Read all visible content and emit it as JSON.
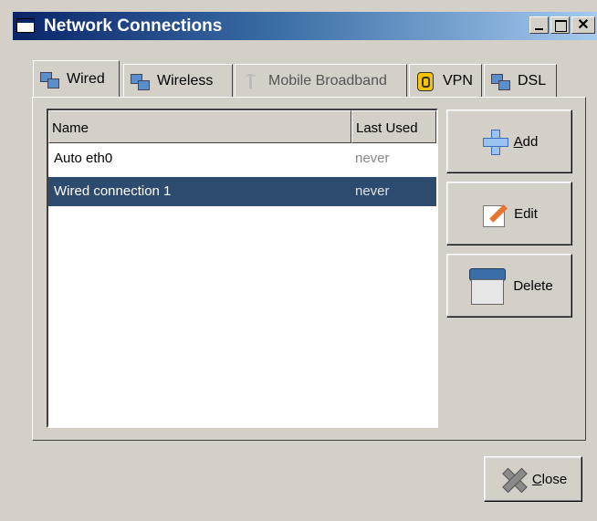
{
  "window": {
    "title": "Network Connections"
  },
  "tabs": [
    {
      "label": "Wired",
      "icon": "wired-network-icon",
      "active": true
    },
    {
      "label": "Wireless",
      "icon": "wireless-network-icon"
    },
    {
      "label": "Mobile Broadband",
      "icon": "mobile-broadband-icon"
    },
    {
      "label": "VPN",
      "icon": "vpn-lock-icon"
    },
    {
      "label": "DSL",
      "icon": "dsl-network-icon"
    }
  ],
  "connections": {
    "columns": [
      "Name",
      "Last Used"
    ],
    "rows": [
      {
        "name": "Auto eth0",
        "last_used": "never",
        "selected": false
      },
      {
        "name": "Wired connection 1",
        "last_used": "never",
        "selected": true
      }
    ]
  },
  "actions": {
    "add": {
      "mnemonic": "A",
      "rest": "dd",
      "icon": "plus-icon"
    },
    "edit": {
      "label": "Edit",
      "icon": "pencil-icon"
    },
    "delete": {
      "label": "Delete",
      "icon": "trash-icon"
    },
    "close": {
      "mnemonic": "C",
      "rest": "lose",
      "icon": "close-x-icon"
    }
  },
  "colors": {
    "selection": "#2c4b6e",
    "titlebar_start": "#0a246a",
    "titlebar_end": "#a6caf0"
  }
}
